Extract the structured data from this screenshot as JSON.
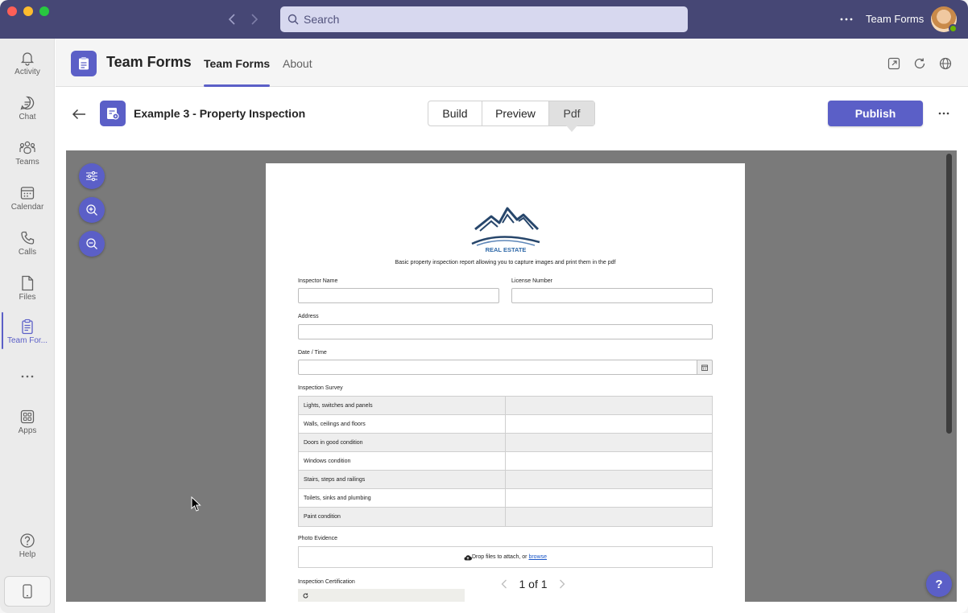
{
  "titlebar": {
    "search_placeholder": "Search",
    "org_name": "Team Forms"
  },
  "rail": {
    "items": [
      {
        "label": "Activity",
        "icon": "bell-icon"
      },
      {
        "label": "Chat",
        "icon": "chat-icon"
      },
      {
        "label": "Teams",
        "icon": "teams-icon"
      },
      {
        "label": "Calendar",
        "icon": "calendar-icon"
      },
      {
        "label": "Calls",
        "icon": "phone-icon"
      },
      {
        "label": "Files",
        "icon": "file-icon"
      },
      {
        "label": "Team For...",
        "icon": "clipboard-icon"
      },
      {
        "label": "Apps",
        "icon": "apps-icon"
      },
      {
        "label": "Help",
        "icon": "help-icon"
      }
    ]
  },
  "app": {
    "title": "Team Forms",
    "tabs": [
      {
        "label": "Team Forms",
        "active": true
      },
      {
        "label": "About",
        "active": false
      }
    ]
  },
  "toolbar": {
    "form_title": "Example 3 - Property Inspection",
    "modes": [
      "Build",
      "Preview",
      "Pdf"
    ],
    "active_mode": "Pdf",
    "publish_label": "Publish"
  },
  "pdf": {
    "logo_text": "REAL ESTATE",
    "description": "Basic property inspection report allowing you to capture images and print them in the pdf",
    "fields": {
      "inspector_name": "Inspector Name",
      "license_number": "License Number",
      "address": "Address",
      "date_time": "Date / Time",
      "inspection_survey": "Inspection Survey",
      "photo_evidence": "Photo Evidence",
      "inspection_certification": "Inspection Certification"
    },
    "survey_rows": [
      "Lights, switches and panels",
      "Walls, ceilings and floors",
      "Doors in good condition",
      "Windows condition",
      "Stairs, steps and railings",
      "Toilets, sinks and plumbing",
      "Paint condition"
    ],
    "dropzone_text": "Drop files to attach, or",
    "dropzone_link": "browse",
    "pager": "1 of 1"
  },
  "colors": {
    "titlebar": "#464775",
    "accent": "#5b5fc7",
    "viewer_bg": "#7a7a7a"
  }
}
